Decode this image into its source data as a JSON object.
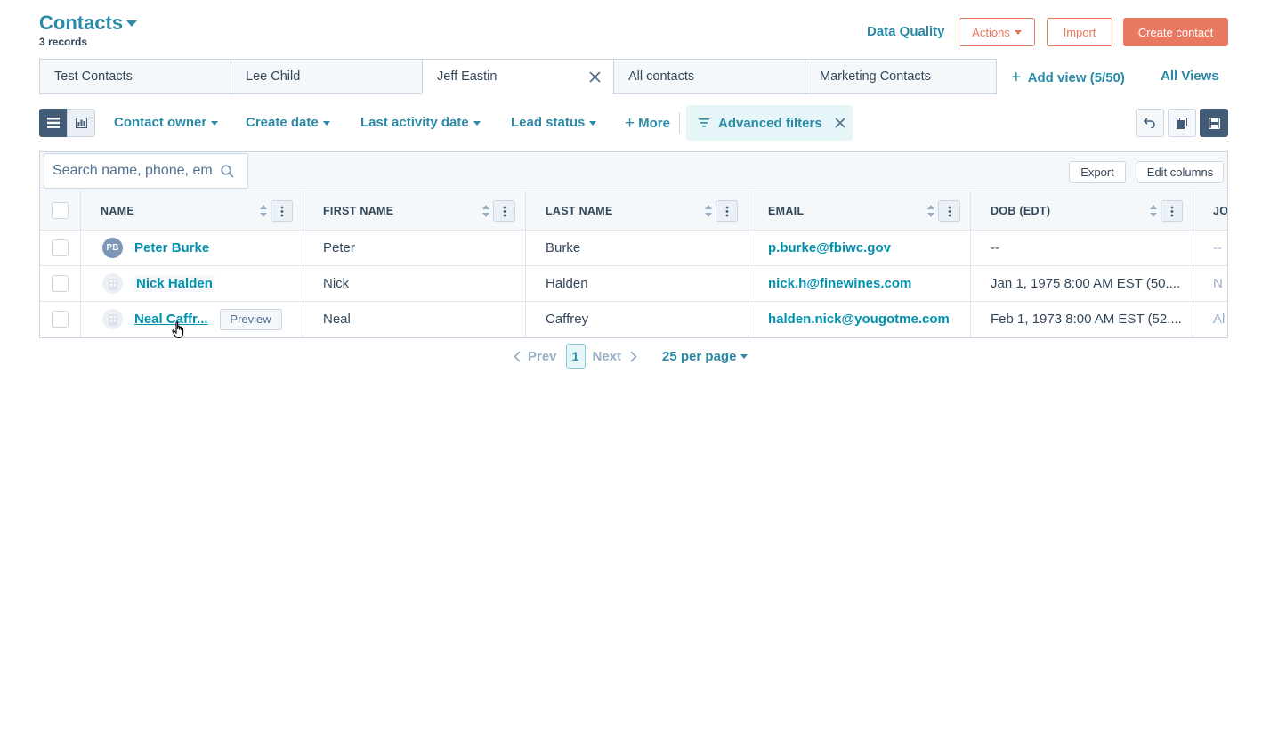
{
  "header": {
    "title": "Contacts",
    "records": "3 records",
    "data_quality": "Data Quality",
    "actions": "Actions",
    "import": "Import",
    "create_contact": "Create contact"
  },
  "tabs": [
    {
      "label": "Test Contacts",
      "active": false
    },
    {
      "label": "Lee Child",
      "active": false
    },
    {
      "label": "Jeff Eastin",
      "active": true
    },
    {
      "label": "All contacts",
      "active": false
    },
    {
      "label": "Marketing Contacts",
      "active": false
    }
  ],
  "add_view": "Add view (5/50)",
  "all_views": "All Views",
  "filters": {
    "contact_owner": "Contact owner",
    "create_date": "Create date",
    "last_activity_date": "Last activity date",
    "lead_status": "Lead status",
    "more": "More",
    "advanced_filters": "Advanced filters"
  },
  "table_tools": {
    "search_placeholder": "Search name, phone, email",
    "export": "Export",
    "edit_columns": "Edit columns"
  },
  "columns": [
    "NAME",
    "FIRST NAME",
    "LAST NAME",
    "EMAIL",
    "DOB (EDT)",
    "JO"
  ],
  "rows": [
    {
      "initials": "PB",
      "name": "Peter Burke",
      "first": "Peter",
      "last": "Burke",
      "email": "p.burke@fbiwc.gov",
      "dob": "--",
      "extra": "--"
    },
    {
      "initials": "",
      "name": "Nick Halden",
      "first": "Nick",
      "last": "Halden",
      "email": "nick.h@finewines.com",
      "dob": "Jan 1, 1975 8:00 AM EST (50....",
      "extra": "N"
    },
    {
      "initials": "",
      "name": "Neal Caffr...",
      "first": "Neal",
      "last": "Caffrey",
      "email": "halden.nick@yougotme.com",
      "dob": "Feb 1, 1973 8:00 AM EST (52....",
      "extra": "Al"
    }
  ],
  "preview_label": "Preview",
  "pagination": {
    "prev": "Prev",
    "page": "1",
    "next": "Next",
    "per_page": "25 per page"
  },
  "colors": {
    "link": "#0091ae",
    "accent": "#e87860",
    "dark": "#425b76"
  }
}
